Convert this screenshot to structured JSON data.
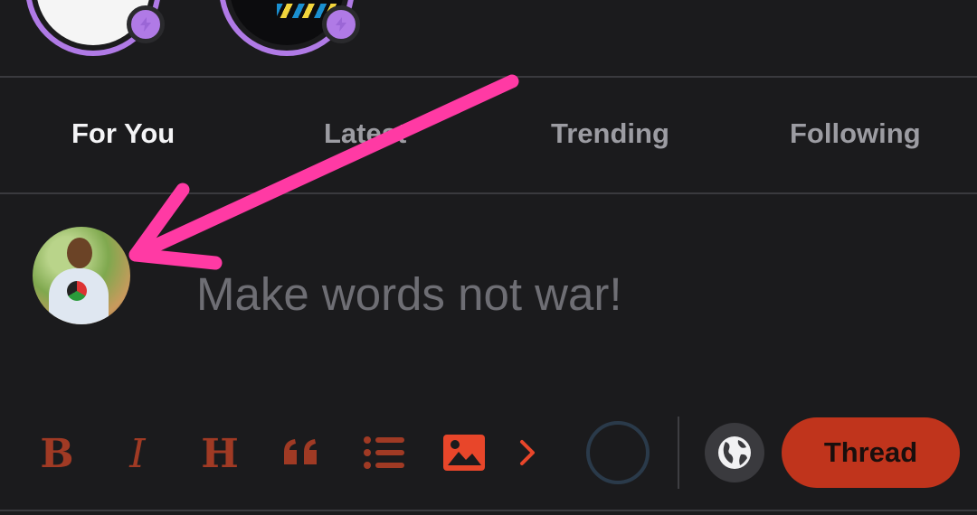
{
  "tabs": [
    {
      "label": "For You",
      "active": true
    },
    {
      "label": "Latest",
      "active": false
    },
    {
      "label": "Trending",
      "active": false
    },
    {
      "label": "Following",
      "active": false
    }
  ],
  "composer": {
    "placeholder": "Make words not war!"
  },
  "toolbar": {
    "bold_icon": "B",
    "italic_icon": "I",
    "heading_icon": "H",
    "quote_icon": "quote-icon",
    "list_icon": "list-icon",
    "image_icon": "image-icon",
    "more_icon": "chevron-right-icon",
    "visibility_icon": "globe-icon",
    "submit_label": "Thread"
  },
  "colors": {
    "background": "#1b1b1d",
    "accent": "#c0341c",
    "toolbar_icon": "#a03a24",
    "image_icon": "#e8462a",
    "story_ring": "#b07ae6",
    "annotation_arrow": "#ff3aa4"
  }
}
